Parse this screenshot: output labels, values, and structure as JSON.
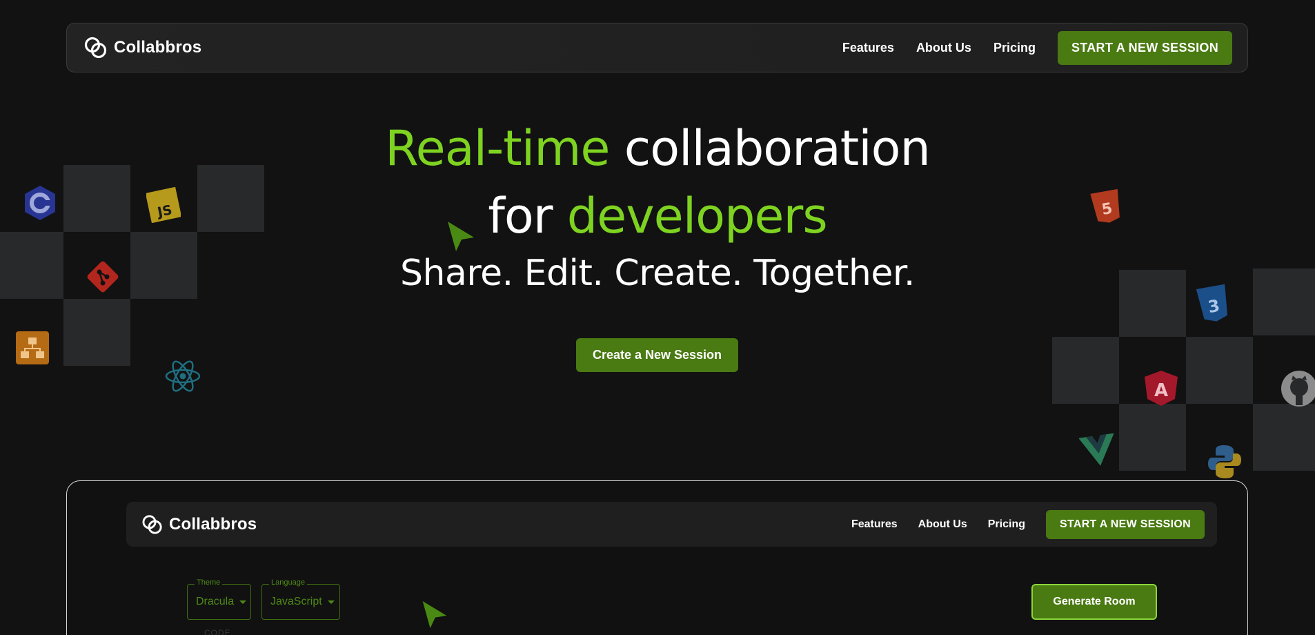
{
  "nav": {
    "brand": "Collabbros",
    "links": [
      "Features",
      "About Us",
      "Pricing"
    ],
    "cta": "START A NEW SESSION"
  },
  "hero": {
    "line1_accent": "Real-time",
    "line1_rest": "collaboration",
    "line2_start": "for",
    "line2_accent": "developers",
    "subtitle": "Share. Edit. Create. Together.",
    "button": "Create a New Session"
  },
  "preview": {
    "brand": "Collabbros",
    "links": [
      "Features",
      "About Us",
      "Pricing"
    ],
    "cta": "START A NEW SESSION",
    "theme_label": "Theme",
    "theme_value": "Dracula",
    "language_label": "Language",
    "language_value": "JavaScript",
    "code_label": "CODE",
    "generate_button": "Generate Room"
  },
  "decorations": {
    "left": [
      "c-icon",
      "javascript-icon",
      "git-icon",
      "diagram-icon",
      "react-icon"
    ],
    "right": [
      "html5-icon",
      "css3-icon",
      "angular-icon",
      "github-icon",
      "vue-icon",
      "python-icon"
    ]
  },
  "colors": {
    "accent": "#7ed321",
    "button": "#4a7a12",
    "background": "#121212"
  }
}
